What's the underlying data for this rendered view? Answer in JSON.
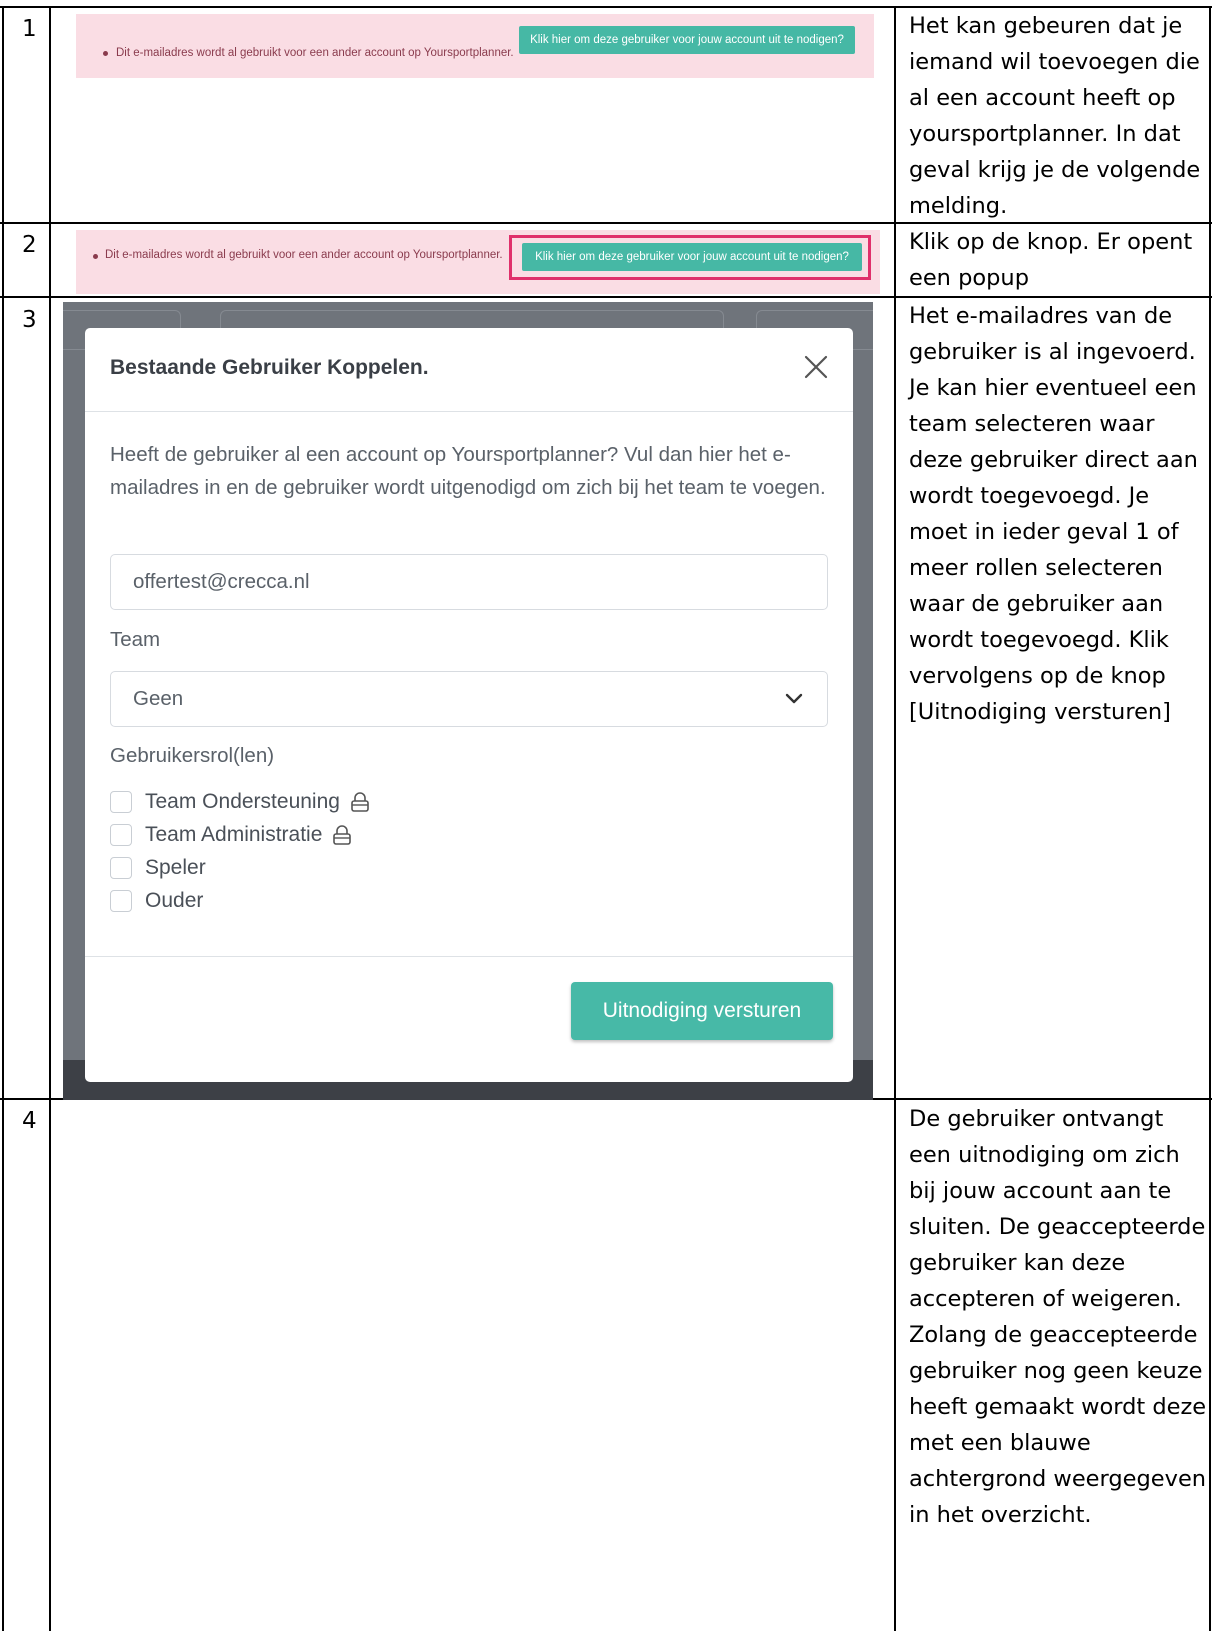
{
  "rows": [
    {
      "number": "1",
      "alert_message": "Dit e-mailadres wordt al gebruikt voor een ander account op Yoursportplanner.",
      "alert_button": "Klik hier om deze gebruiker voor jouw account uit te nodigen?",
      "description": "Het kan gebeuren dat je iemand wil toevoegen die al een account heeft op yoursportplanner. In dat geval krijg je de volgende melding."
    },
    {
      "number": "2",
      "alert_message": "Dit e-mailadres wordt al gebruikt voor een ander account op Yoursportplanner.",
      "alert_button": "Klik hier om deze gebruiker voor jouw account uit te nodigen?",
      "description": "Klik op de knop. Er opent een popup"
    },
    {
      "number": "3",
      "description": "Het e-mailadres van de gebruiker is al ingevoerd. Je kan hier eventueel een team selecteren waar deze gebruiker direct aan wordt toegevoegd. Je moet in ieder geval 1 of meer rollen selecteren waar de gebruiker aan wordt toegevoegd. Klik vervolgens op de knop [Uitnodiging versturen]"
    },
    {
      "number": "4",
      "description": "De gebruiker ontvangt een uitnodiging om zich bij jouw account aan te sluiten. De geaccepteerde gebruiker kan deze accepteren of weigeren. Zolang de geaccepteerde gebruiker nog geen keuze heeft gemaakt wordt deze met een blauwe achtergrond weergegeven in het overzicht."
    }
  ],
  "modal": {
    "title": "Bestaande Gebruiker Koppelen.",
    "intro": "Heeft de gebruiker al een account op Yoursportplanner? Vul dan hier het e-mailadres in en de gebruiker wordt uitgenodigd om zich bij het team te voegen.",
    "email_value": "offertest@crecca.nl",
    "team_label": "Team",
    "team_selected": "Geen",
    "roles_label": "Gebruikersrol(len)",
    "roles": [
      {
        "label": "Team Ondersteuning",
        "locked": true,
        "checked": false
      },
      {
        "label": "Team Administratie",
        "locked": true,
        "checked": false
      },
      {
        "label": "Speler",
        "locked": false,
        "checked": false
      },
      {
        "label": "Ouder",
        "locked": false,
        "checked": false
      }
    ],
    "submit_label": "Uitnodiging versturen"
  },
  "colors": {
    "alert_bg": "#fadde4",
    "alert_text": "#8a3b4d",
    "teal_button": "#46b8a5",
    "highlight": "#e0306b",
    "overlay": "#6f747b"
  }
}
